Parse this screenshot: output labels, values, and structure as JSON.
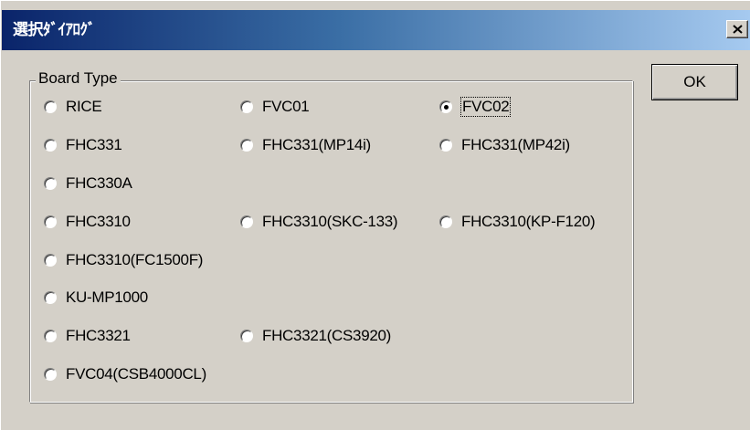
{
  "window": {
    "title": "選択ﾀﾞｲｱﾛｸﾞ",
    "title_bar_colors": [
      "#0a246a",
      "#3a6ea5",
      "#a6caf0"
    ],
    "close_icon": "close-icon"
  },
  "group": {
    "label": "Board Type"
  },
  "options": [
    {
      "label": "RICE",
      "selected": false
    },
    {
      "label": "FVC01",
      "selected": false
    },
    {
      "label": "FVC02",
      "selected": true
    },
    {
      "label": "FHC331",
      "selected": false
    },
    {
      "label": "FHC331(MP14i)",
      "selected": false
    },
    {
      "label": "FHC331(MP42i)",
      "selected": false
    },
    {
      "label": "FHC330A",
      "selected": false
    },
    {
      "label": "FHC3310",
      "selected": false
    },
    {
      "label": "FHC3310(SKC-133)",
      "selected": false
    },
    {
      "label": "FHC3310(KP-F120)",
      "selected": false
    },
    {
      "label": "FHC3310(FC1500F)",
      "selected": false
    },
    {
      "label": "KU-MP1000",
      "selected": false
    },
    {
      "label": "FHC3321",
      "selected": false
    },
    {
      "label": "FHC3321(CS3920)",
      "selected": false
    },
    {
      "label": "FVC04(CSB4000CL)",
      "selected": false
    }
  ],
  "buttons": {
    "ok_label": "OK"
  }
}
